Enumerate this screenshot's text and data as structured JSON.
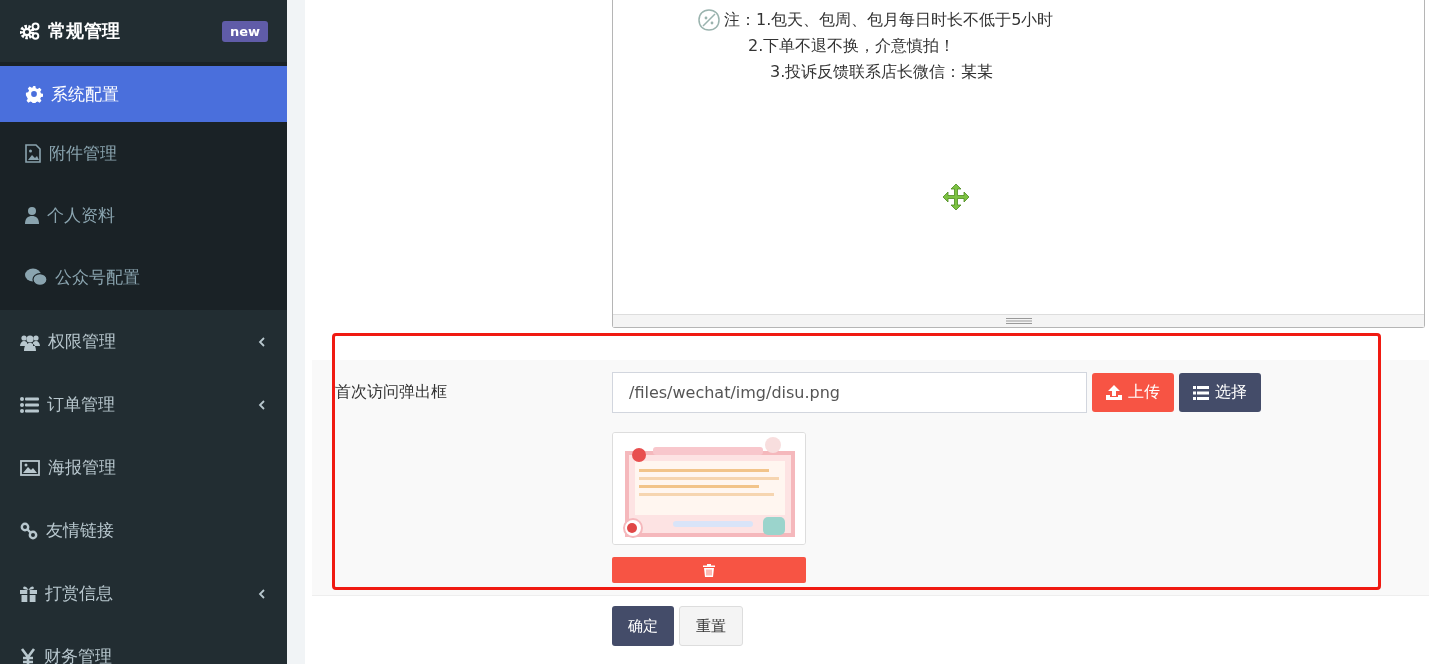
{
  "sidebar": {
    "items": [
      {
        "label": "常规管理",
        "badge": "new",
        "children": [
          {
            "label": "系统配置",
            "selected": true
          },
          {
            "label": "附件管理",
            "selected": false
          },
          {
            "label": "个人资料",
            "selected": false
          },
          {
            "label": "公众号配置",
            "selected": false
          }
        ]
      },
      {
        "label": "权限管理",
        "expandable": true
      },
      {
        "label": "订单管理",
        "expandable": true
      },
      {
        "label": "海报管理",
        "expandable": false
      },
      {
        "label": "友情链接",
        "expandable": false
      },
      {
        "label": "打赏信息",
        "expandable": true
      },
      {
        "label": "财务管理",
        "expandable": false
      }
    ]
  },
  "editor": {
    "lines": [
      "注：1.包天、包周、包月每日时长不低于5小时",
      "2.下单不退不换，介意慎拍！",
      "3.投诉反馈联系店长微信：某某"
    ]
  },
  "form": {
    "label": "首次访问弹出框",
    "value": "/files/wechat/img/disu.png",
    "upload_button": "上传",
    "choose_button": "选择"
  },
  "actions": [
    "确定",
    "重置"
  ]
}
